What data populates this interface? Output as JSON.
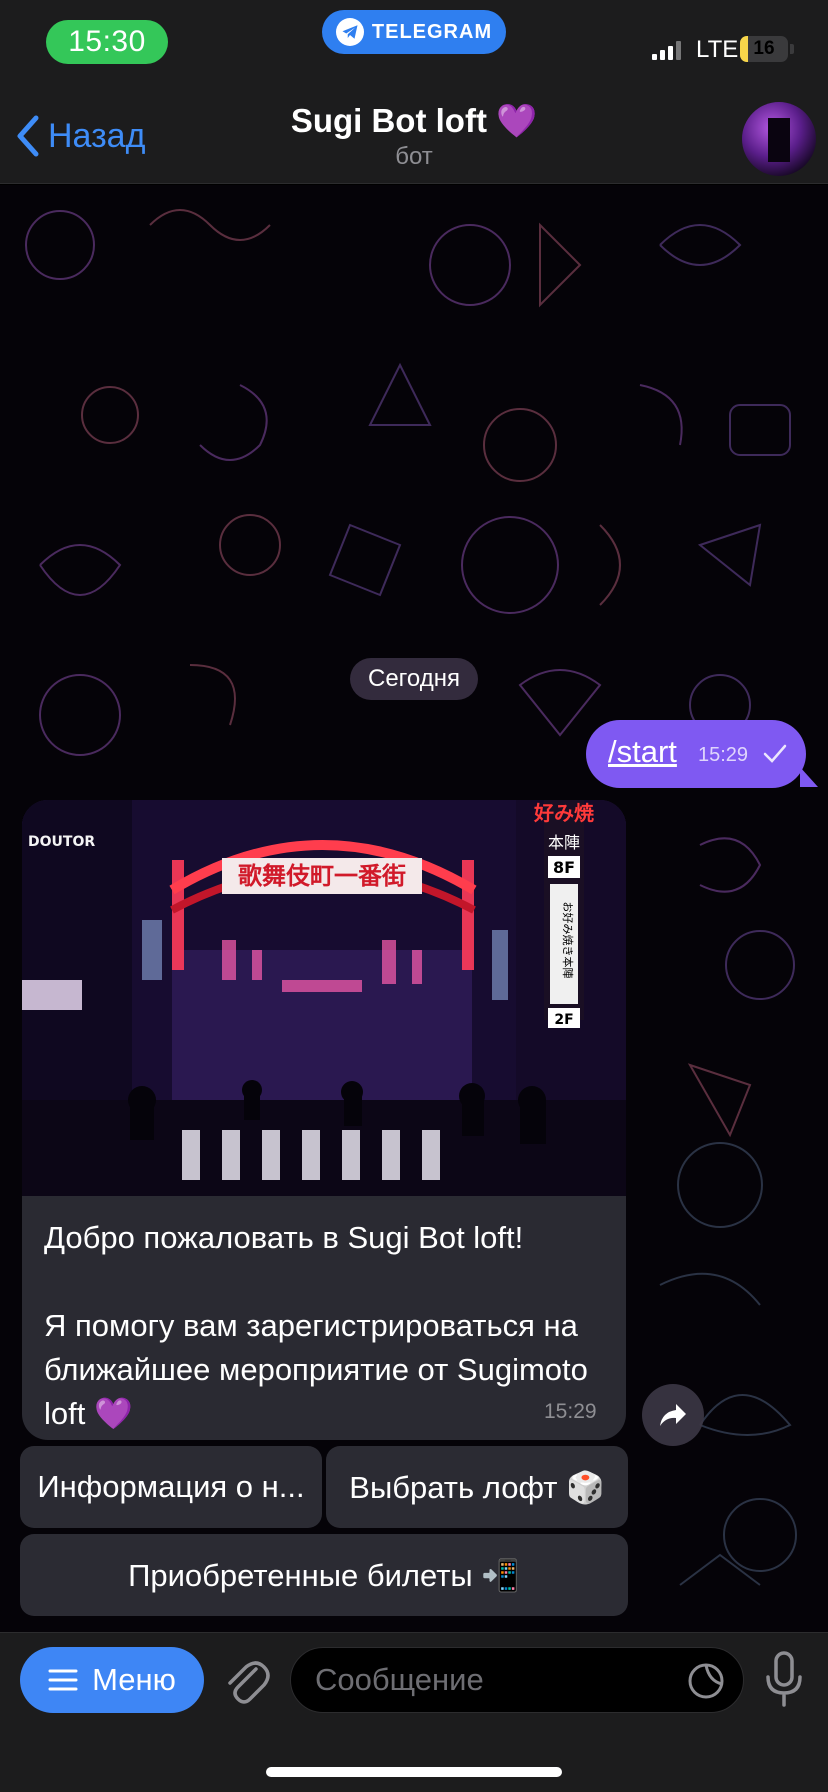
{
  "status_bar": {
    "time": "15:30",
    "app_pill": "TELEGRAM",
    "network": "LTE",
    "battery": "16",
    "battery_level": 0.16,
    "colors": {
      "time_pill": "#34c759",
      "app_pill": "#2f7ff0"
    }
  },
  "nav": {
    "back_label": "Назад",
    "title": "Sugi Bot loft 💜",
    "subtitle": "бот"
  },
  "chat": {
    "date_chip": "Сегодня",
    "outgoing": {
      "text": "/start",
      "time": "15:29",
      "color": "#7f59f2"
    },
    "incoming": {
      "photo_signs": [
        "歌舞伎町一番街",
        "好み焼",
        "本陣",
        "8F",
        "お好み焼き本陣",
        "2F",
        "DOUTOR"
      ],
      "text": "Добро пожаловать в Sugi Bot loft!\n\nЯ помогу вам зарегистрироваться на ближайшее мероприятие от Sugimoto loft 💜",
      "time": "15:29"
    },
    "keyboard": [
      {
        "label": "Информация о н..."
      },
      {
        "label": "Выбрать лофт 🎲"
      },
      {
        "label": "Приобретенные билеты 📲"
      }
    ]
  },
  "input_bar": {
    "menu_label": "Меню",
    "placeholder": "Сообщение",
    "accent": "#3e86f5"
  },
  "icons": [
    "telegram-plane-icon",
    "signal-icon",
    "battery-icon",
    "back-chevron-icon",
    "check-icon",
    "share-icon",
    "menu-lines-icon",
    "paperclip-icon",
    "sticker-icon",
    "mic-icon"
  ]
}
